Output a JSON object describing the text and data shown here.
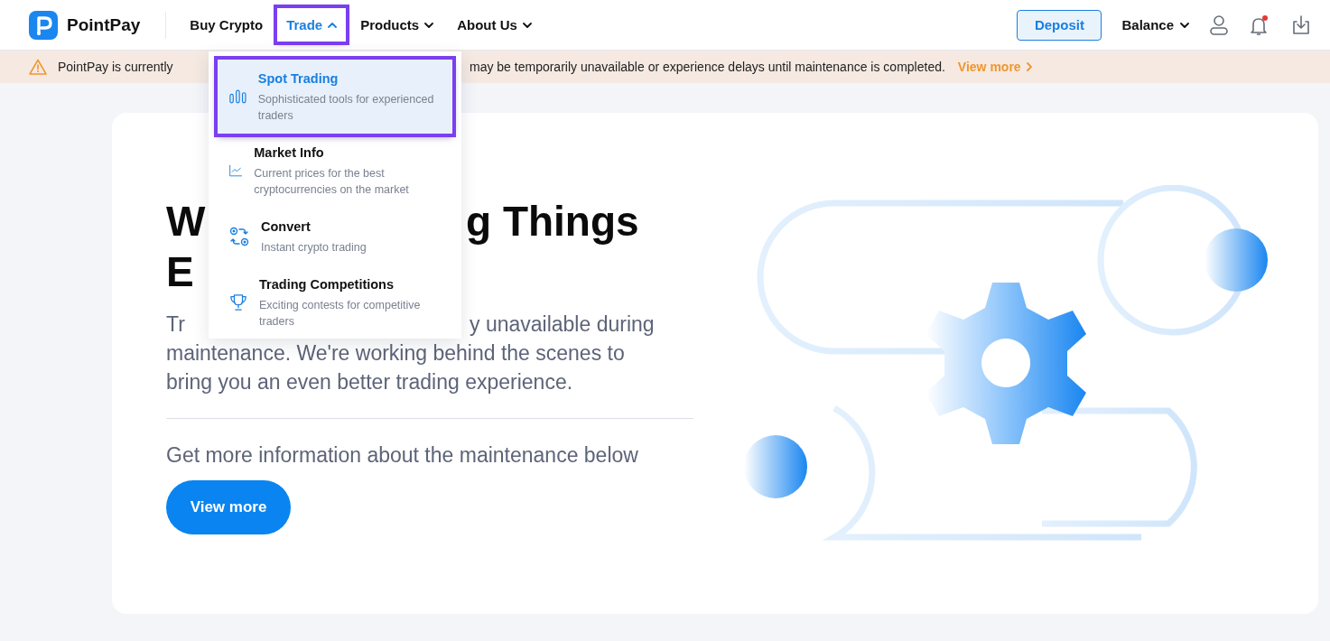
{
  "header": {
    "logo": "PointPay",
    "nav": [
      {
        "label": "Buy Crypto",
        "selected": false,
        "highlighted": false
      },
      {
        "label": "Trade",
        "selected": true,
        "highlighted": true,
        "expanded": true
      },
      {
        "label": "Products",
        "selected": false,
        "highlighted": false,
        "expanded": false
      },
      {
        "label": "About Us",
        "selected": false,
        "highlighted": false,
        "expanded": false
      }
    ],
    "deposit": "Deposit",
    "balance": "Balance",
    "notification_unread": true
  },
  "banner": {
    "text_left": "PointPay is currently",
    "text_right": "may be temporarily unavailable or experience delays until maintenance is completed.",
    "link": "View more"
  },
  "menu": {
    "items": [
      {
        "title": "Spot Trading",
        "description": "Sophisticated tools for experienced traders",
        "selected": true,
        "highlighted": true
      },
      {
        "title": "Market Info",
        "description": "Current prices for the best cryptocurrencies on the market",
        "selected": false,
        "highlighted": false
      },
      {
        "title": "Convert",
        "description": "Instant crypto trading",
        "selected": false,
        "highlighted": false
      },
      {
        "title": "Trading Competitions",
        "description": "Exciting contests for competitive traders",
        "selected": false,
        "highlighted": false
      }
    ]
  },
  "hero": {
    "heading_lines": [
      {
        "left": "W",
        "right": "g Things"
      },
      {
        "left": "E"
      }
    ],
    "paragraph_lines": [
      {
        "left": "Tr",
        "right": "y unavailable during"
      },
      {
        "left": "maintenance. We're working behind the scenes to"
      },
      {
        "left": "bring you an even better trading experience."
      }
    ],
    "info": "Get more information about the maintenance below",
    "button": "View more"
  }
}
